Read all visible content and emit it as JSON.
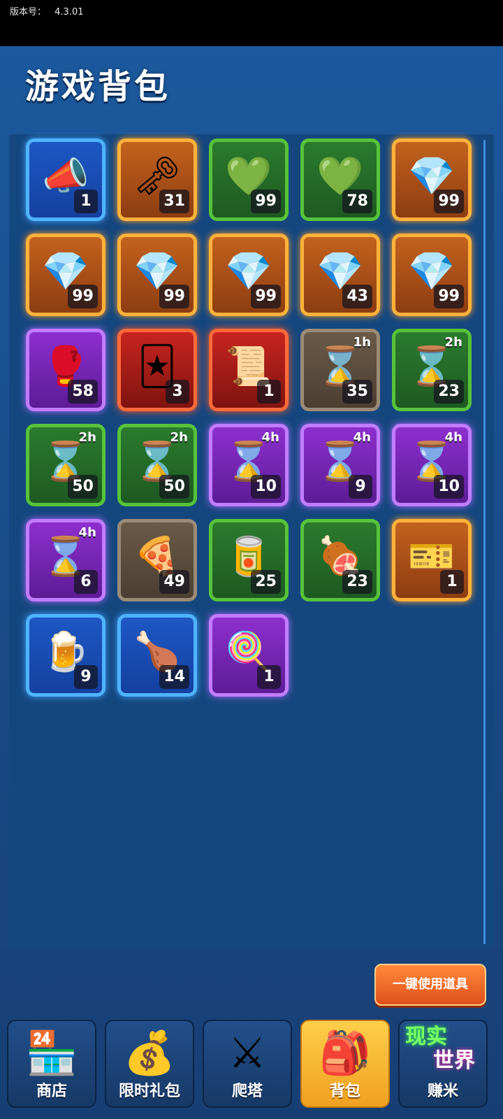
{
  "status": {
    "version_label": "版本号：",
    "version": "4.3.01"
  },
  "page": {
    "title": "游戏背包"
  },
  "inventory": {
    "items": [
      {
        "name": "megaphone",
        "icon": "📣",
        "count": "1",
        "rarity": "blue",
        "tag": ""
      },
      {
        "name": "key",
        "icon": "🗝",
        "count": "31",
        "rarity": "orange",
        "tag": ""
      },
      {
        "name": "green-gem",
        "icon": "💚",
        "count": "99",
        "rarity": "green",
        "tag": ""
      },
      {
        "name": "green-gem",
        "icon": "💚",
        "count": "78",
        "rarity": "green",
        "tag": ""
      },
      {
        "name": "blue-gem",
        "icon": "💎",
        "count": "99",
        "rarity": "orange",
        "tag": ""
      },
      {
        "name": "blue-gem",
        "icon": "💎",
        "count": "99",
        "rarity": "orange",
        "tag": ""
      },
      {
        "name": "blue-gem",
        "icon": "💎",
        "count": "99",
        "rarity": "orange",
        "tag": ""
      },
      {
        "name": "blue-gem",
        "icon": "💎",
        "count": "99",
        "rarity": "orange",
        "tag": ""
      },
      {
        "name": "blue-gem",
        "icon": "💎",
        "count": "43",
        "rarity": "orange",
        "tag": ""
      },
      {
        "name": "blue-gem",
        "icon": "💎",
        "count": "99",
        "rarity": "orange",
        "tag": ""
      },
      {
        "name": "boxing-glove",
        "icon": "🥊",
        "count": "58",
        "rarity": "purple",
        "tag": ""
      },
      {
        "name": "time-card-gray",
        "icon": "🃏",
        "count": "3",
        "rarity": "red",
        "tag": ""
      },
      {
        "name": "scroll",
        "icon": "📜",
        "count": "1",
        "rarity": "red",
        "tag": ""
      },
      {
        "name": "hourglass-card",
        "icon": "⌛",
        "count": "35",
        "rarity": "brown",
        "tag": "1h"
      },
      {
        "name": "hourglass-card",
        "icon": "⌛",
        "count": "23",
        "rarity": "green",
        "tag": "2h"
      },
      {
        "name": "hourglass-card",
        "icon": "⌛",
        "count": "50",
        "rarity": "green",
        "tag": "2h"
      },
      {
        "name": "hourglass-card",
        "icon": "⌛",
        "count": "50",
        "rarity": "green",
        "tag": "2h"
      },
      {
        "name": "hourglass-card",
        "icon": "⌛",
        "count": "10",
        "rarity": "purple",
        "tag": "4h"
      },
      {
        "name": "hourglass-card",
        "icon": "⌛",
        "count": "9",
        "rarity": "purple",
        "tag": "4h"
      },
      {
        "name": "hourglass-card",
        "icon": "⌛",
        "count": "10",
        "rarity": "purple",
        "tag": "4h"
      },
      {
        "name": "hourglass-card",
        "icon": "⌛",
        "count": "6",
        "rarity": "purple",
        "tag": "4h"
      },
      {
        "name": "pizza",
        "icon": "🍕",
        "count": "49",
        "rarity": "brown",
        "tag": ""
      },
      {
        "name": "canned-food",
        "icon": "🥫",
        "count": "25",
        "rarity": "green",
        "tag": ""
      },
      {
        "name": "meat",
        "icon": "🍖",
        "count": "23",
        "rarity": "green",
        "tag": ""
      },
      {
        "name": "vip-card",
        "icon": "🎫",
        "count": "1",
        "rarity": "orange",
        "tag": ""
      },
      {
        "name": "beer-mug",
        "icon": "🍺",
        "count": "9",
        "rarity": "blue",
        "tag": ""
      },
      {
        "name": "roast-chicken",
        "icon": "🍗",
        "count": "14",
        "rarity": "blue",
        "tag": ""
      },
      {
        "name": "lollipop",
        "icon": "🍭",
        "count": "1",
        "rarity": "purple",
        "tag": ""
      }
    ]
  },
  "actions": {
    "use_all": "一键使用道具"
  },
  "nav": {
    "shop": "商店",
    "gift": "限时礼包",
    "tower": "爬塔",
    "bag": "背包",
    "earn": "赚米",
    "earn_badge_line1": "现实",
    "earn_badge_line2": "世界"
  }
}
